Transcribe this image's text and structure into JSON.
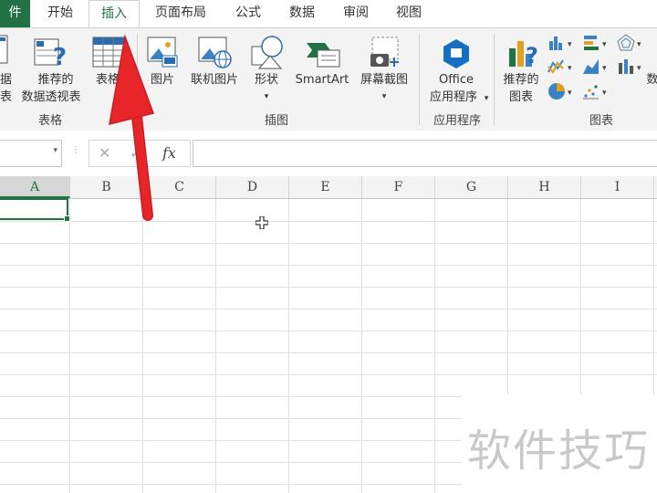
{
  "tabs": [
    {
      "id": "file",
      "label": "件"
    },
    {
      "id": "home",
      "label": "开始"
    },
    {
      "id": "insert",
      "label": "插入"
    },
    {
      "id": "layout",
      "label": "页面布局"
    },
    {
      "id": "formulas",
      "label": "公式"
    },
    {
      "id": "data",
      "label": "数据"
    },
    {
      "id": "review",
      "label": "审阅"
    },
    {
      "id": "view",
      "label": "视图"
    }
  ],
  "ribbon": {
    "pivot_partial_top": "据",
    "pivot_partial_bottom": "表",
    "recommended_pivot_line1": "推荐的",
    "recommended_pivot_line2": "数据透视表",
    "table_label": "表格",
    "group_tables": "表格",
    "picture": "图片",
    "online_picture": "联机图片",
    "shapes": "形状",
    "smartart": "SmartArt",
    "screenshot": "屏幕截图",
    "group_illustrations": "插图",
    "office_line1": "Office",
    "office_line2": "应用程序",
    "group_apps": "应用程序",
    "recommended_charts_line1": "推荐的",
    "recommended_charts_line2": "图表",
    "group_charts": "图表",
    "partial_right": "数"
  },
  "formula_bar": {
    "namebox_value": "",
    "cancel_symbol": "✕",
    "confirm_symbol": "✓",
    "fx_label": "fx",
    "formula_value": ""
  },
  "columns": [
    "A",
    "B",
    "C",
    "D",
    "E",
    "F",
    "G",
    "H",
    "I"
  ],
  "watermark": "软件技巧",
  "colors": {
    "accent": "#217346",
    "arrow": "#e8262a",
    "ribbon_bg": "#f3f3f3"
  }
}
